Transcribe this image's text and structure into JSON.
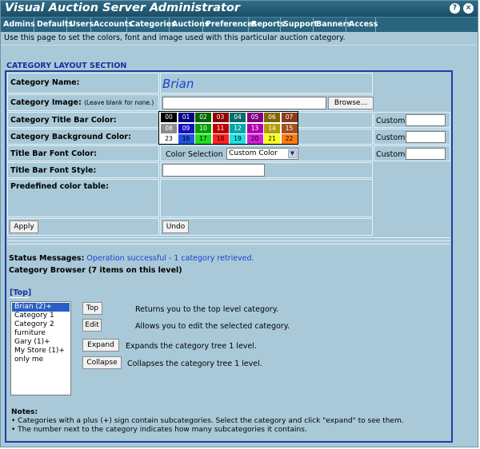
{
  "window": {
    "title": "Visual Auction Server Administrator",
    "help_glyph": "?",
    "close_glyph": "×"
  },
  "menu": [
    "Admins",
    "Defaults",
    "Users",
    "Accounts",
    "Categories",
    "Auctions",
    "Preferences",
    "Reports",
    "Support",
    "Banners",
    "Access"
  ],
  "intro": "Use this page to set the colors, font and image used with this particular auction category.",
  "section_title": "CATEGORY LAYOUT SECTION",
  "form": {
    "name_label": "Category Name:",
    "name_value": "Brian",
    "image_label": "Category Image:",
    "image_hint": "(Leave blank for none.)",
    "image_value": "",
    "browse_label": "Browse...",
    "title_bar_color_label": "Category Title Bar Color:",
    "background_color_label": "Category Background Color:",
    "font_color_label": "Title Bar Font Color:",
    "font_style_label": "Title Bar Font Style:",
    "font_style_value": "",
    "color_selection_text": "Color Selection",
    "select_value": "Custom Color",
    "custom_text": "Custom",
    "predefined_label": "Predefined color table:",
    "apply_label": "Apply",
    "undo_label": "Undo"
  },
  "palette": [
    {
      "n": "00",
      "bg": "#000000",
      "fg": "#ffffff"
    },
    {
      "n": "01",
      "bg": "#000080",
      "fg": "#ffffff"
    },
    {
      "n": "02",
      "bg": "#006400",
      "fg": "#ffffff"
    },
    {
      "n": "03",
      "bg": "#8b0000",
      "fg": "#ffffff"
    },
    {
      "n": "04",
      "bg": "#006c6c",
      "fg": "#ffffff"
    },
    {
      "n": "05",
      "bg": "#800080",
      "fg": "#ffffff"
    },
    {
      "n": "06",
      "bg": "#806600",
      "fg": "#ffffff"
    },
    {
      "n": "07",
      "bg": "#8b3a1a",
      "fg": "#ffffff"
    },
    {
      "n": "08",
      "bg": "#8c8c8c",
      "fg": "#ffffff"
    },
    {
      "n": "09",
      "bg": "#1010c0",
      "fg": "#ffffff"
    },
    {
      "n": "10",
      "bg": "#00a000",
      "fg": "#ffffff"
    },
    {
      "n": "11",
      "bg": "#c00000",
      "fg": "#ffffff"
    },
    {
      "n": "12",
      "bg": "#00a8a8",
      "fg": "#ffffff"
    },
    {
      "n": "13",
      "bg": "#b000b0",
      "fg": "#ffffff"
    },
    {
      "n": "14",
      "bg": "#b0a000",
      "fg": "#ffffff"
    },
    {
      "n": "15",
      "bg": "#a0521d",
      "fg": "#ffffff"
    },
    {
      "n": "23",
      "bg": "#ffffff",
      "fg": "#000000"
    },
    {
      "n": "16",
      "bg": "#2255dd",
      "fg": "#000000"
    },
    {
      "n": "17",
      "bg": "#22dd22",
      "fg": "#000000"
    },
    {
      "n": "18",
      "bg": "#ff2020",
      "fg": "#000000"
    },
    {
      "n": "19",
      "bg": "#20e0e0",
      "fg": "#000000"
    },
    {
      "n": "20",
      "bg": "#d020d0",
      "fg": "#000000"
    },
    {
      "n": "21",
      "bg": "#ffff20",
      "fg": "#000000"
    },
    {
      "n": "22",
      "bg": "#ff7a10",
      "fg": "#000000"
    }
  ],
  "status": {
    "label": "Status Messages:",
    "message": "Operation successful - 1 category retrieved."
  },
  "browser": {
    "title": "Category Browser (7 items on this level)",
    "top_link": "[Top]",
    "items": [
      "Brian (2)+",
      "Category 1",
      "Category 2",
      "furniture",
      "Gary (1)+",
      "My Store (1)+",
      "only me"
    ],
    "selected_index": 0,
    "buttons": [
      {
        "label": "Top",
        "desc": "Returns you to the top level category."
      },
      {
        "label": "Edit",
        "desc": "Allows you to edit the selected category."
      },
      {
        "label": "Expand",
        "desc": "Expands the category tree 1 level."
      },
      {
        "label": "Collapse",
        "desc": "Collapses the category tree 1 level."
      }
    ]
  },
  "notes": {
    "title": "Notes:",
    "items": [
      "Categories with a plus (+) sign contain subcategories. Select the category and click \"expand\" to see them.",
      "The number next to the category indicates how many subcategories it contains."
    ]
  },
  "colors": {
    "background": "#a9c9d8",
    "titlebar": "#1c4e66",
    "section_heading": "#1a2f9a",
    "status_message": "#1a3fd0",
    "selection": "#2b5ec4"
  }
}
